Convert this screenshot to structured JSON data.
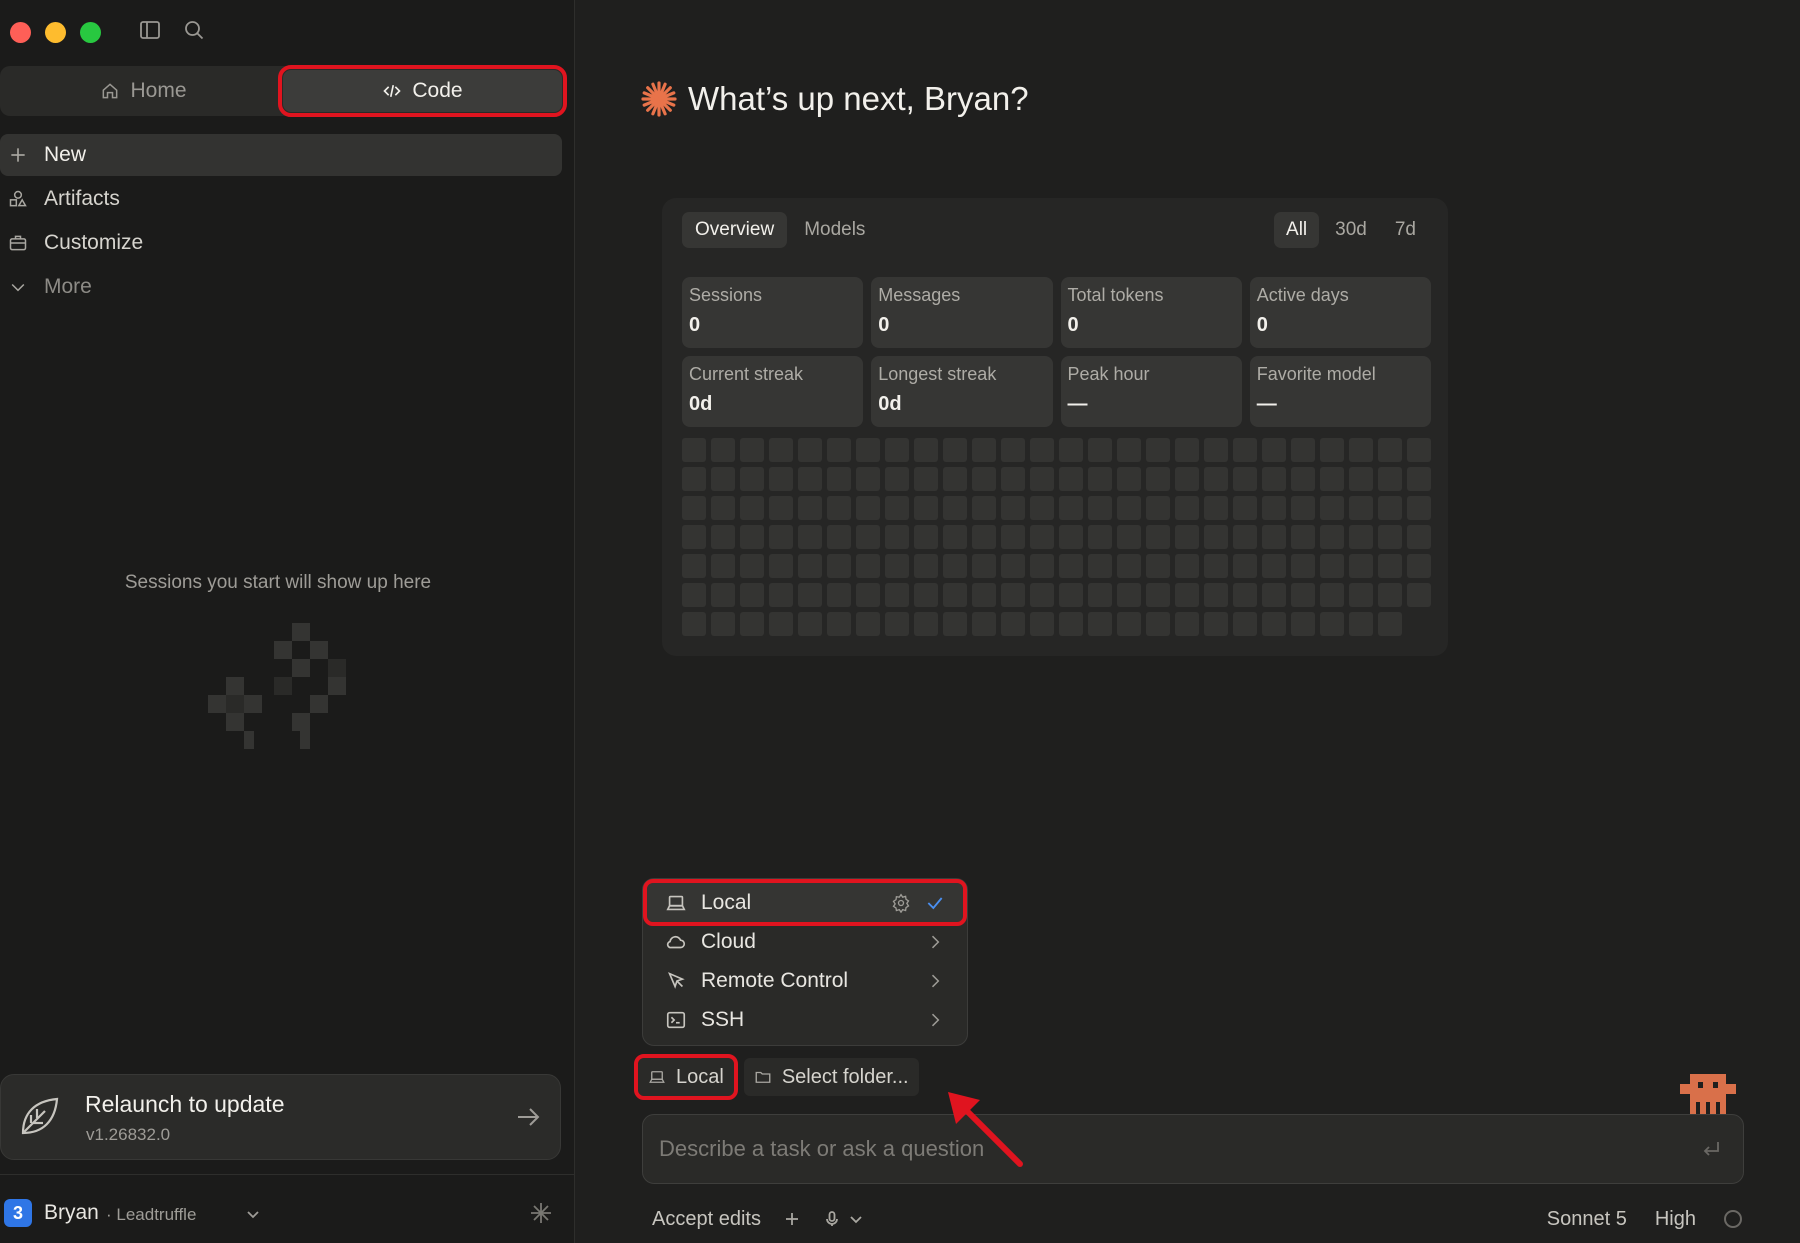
{
  "sidebar": {
    "tabs": [
      {
        "label": "Home",
        "icon": "home-icon"
      },
      {
        "label": "Code",
        "icon": "code-icon",
        "active": true
      }
    ],
    "nav": [
      {
        "label": "New",
        "icon": "plus-icon"
      },
      {
        "label": "Artifacts",
        "icon": "shapes-icon"
      },
      {
        "label": "Customize",
        "icon": "briefcase-icon"
      },
      {
        "label": "More",
        "icon": "chevron-down-icon"
      }
    ],
    "empty_text": "Sessions you start will show up here",
    "update": {
      "title": "Relaunch to update",
      "version": "v1.26832.0"
    },
    "user": {
      "initial": "3",
      "name": "Bryan",
      "org": "· Leadtruffle"
    }
  },
  "main": {
    "greeting": "What’s up next, Bryan?",
    "stats": {
      "tabs": [
        "Overview",
        "Models"
      ],
      "ranges": [
        "All",
        "30d",
        "7d"
      ],
      "cards": [
        {
          "label": "Sessions",
          "value": "0"
        },
        {
          "label": "Messages",
          "value": "0"
        },
        {
          "label": "Total tokens",
          "value": "0"
        },
        {
          "label": "Active days",
          "value": "0"
        },
        {
          "label": "Current streak",
          "value": "0d"
        },
        {
          "label": "Longest streak",
          "value": "0d"
        },
        {
          "label": "Peak hour",
          "value": "—"
        },
        {
          "label": "Favorite model",
          "value": "—"
        }
      ]
    },
    "env_menu": [
      {
        "label": "Local",
        "icon": "laptop-icon",
        "selected": true
      },
      {
        "label": "Cloud",
        "icon": "cloud-icon"
      },
      {
        "label": "Remote Control",
        "icon": "cursor-icon"
      },
      {
        "label": "SSH",
        "icon": "terminal-icon"
      }
    ],
    "chips": {
      "environment": "Local",
      "folder": "Select folder..."
    },
    "prompt_placeholder": "Describe a task or ask a question",
    "footer": {
      "mode": "Accept edits",
      "model": "Sonnet 5",
      "effort": "High"
    }
  },
  "colors": {
    "accent": "#e0141f",
    "spark": "#e8734a",
    "check": "#4a8ff0"
  }
}
